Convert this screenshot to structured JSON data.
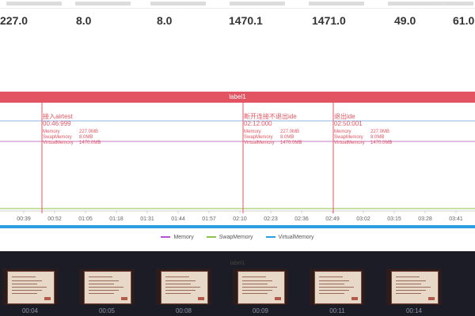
{
  "metrics": [
    "227.0",
    "8.0",
    "8.0",
    "1470.1",
    "1471.0",
    "49.0",
    "61.0"
  ],
  "label_bar": "label1",
  "events": [
    {
      "title": "接入airtest",
      "time": "00:46:999",
      "memory": "227.0MB",
      "swap": "8.0MB",
      "virtual": "1470.0MB"
    },
    {
      "title": "断开连接不退出ide",
      "time": "02:12:000",
      "memory": "227.0MB",
      "swap": "8.0MB",
      "virtual": "1470.0MB"
    },
    {
      "title": "退出ide",
      "time": "02:50:001",
      "memory": "227.0MB",
      "swap": "8.0MB",
      "virtual": "1470.0MB"
    }
  ],
  "field_labels": {
    "memory": "Memory",
    "swap": "SwapMemory",
    "virtual": "VirtualMemory"
  },
  "x_ticks": [
    "00:39",
    "00:52",
    "01:05",
    "01:18",
    "01:31",
    "01:44",
    "01:57",
    "02:10",
    "02:23",
    "02:36",
    "02:49",
    "03:02",
    "03:15",
    "03:28",
    "03:41"
  ],
  "legend": [
    {
      "name": "Memory",
      "color": "#b452d4"
    },
    {
      "name": "SwapMemory",
      "color": "#8bc34a"
    },
    {
      "name": "VirtualMemory",
      "color": "#2c9ee0"
    }
  ],
  "colors": {
    "accent": "#e35462",
    "virtual_line": "#2c9ee0",
    "memory_line": "#b452d4",
    "swap_line": "#8bc34a"
  },
  "filmstrip": {
    "label": "label1",
    "frames": [
      "00:04",
      "00:05",
      "00:08",
      "00:09",
      "00:11",
      "00:14"
    ]
  }
}
